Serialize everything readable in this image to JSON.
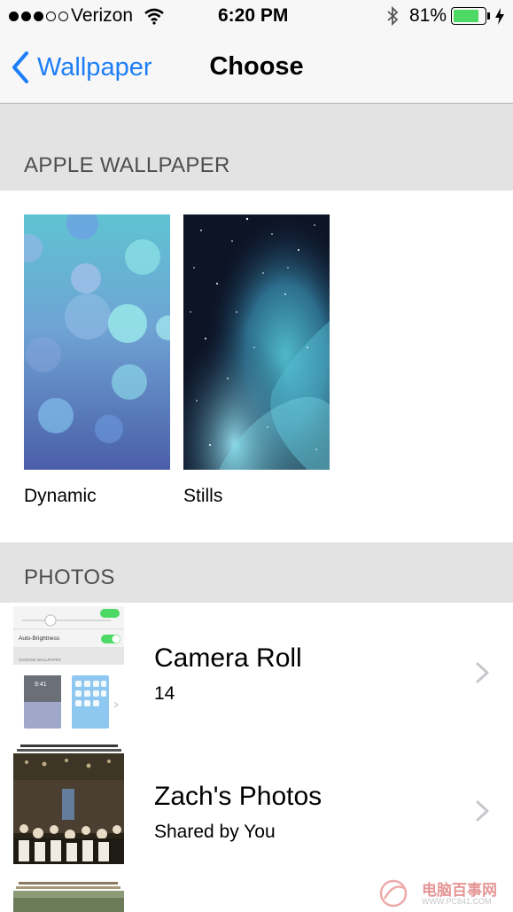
{
  "status_bar": {
    "carrier": "Verizon",
    "time": "6:20 PM",
    "battery": "81%",
    "battery_level": 0.81,
    "signal_bars_filled": 3,
    "signal_bars_total": 5
  },
  "nav": {
    "back_label": "Wallpaper",
    "title": "Choose"
  },
  "apple_wallpaper": {
    "header": "APPLE WALLPAPER",
    "items": [
      {
        "label": "Dynamic"
      },
      {
        "label": "Stills"
      }
    ]
  },
  "photos": {
    "header": "PHOTOS",
    "albums": [
      {
        "title": "Camera Roll",
        "subtitle": "14"
      },
      {
        "title": "Zach's Photos",
        "subtitle": "Shared by You"
      }
    ],
    "camera_roll_thumb": {
      "auto_brightness": "Auto-Brightness",
      "choose_wallpaper": "CHOOSE WALLPAPER",
      "time": "9:41"
    }
  },
  "watermark": {
    "text": "电脑百事网",
    "url": "WWW.PC841.COM"
  },
  "colors": {
    "accent": "#1d7ef7",
    "battery": "#4cd964",
    "section_bg": "#e3e3e3"
  }
}
